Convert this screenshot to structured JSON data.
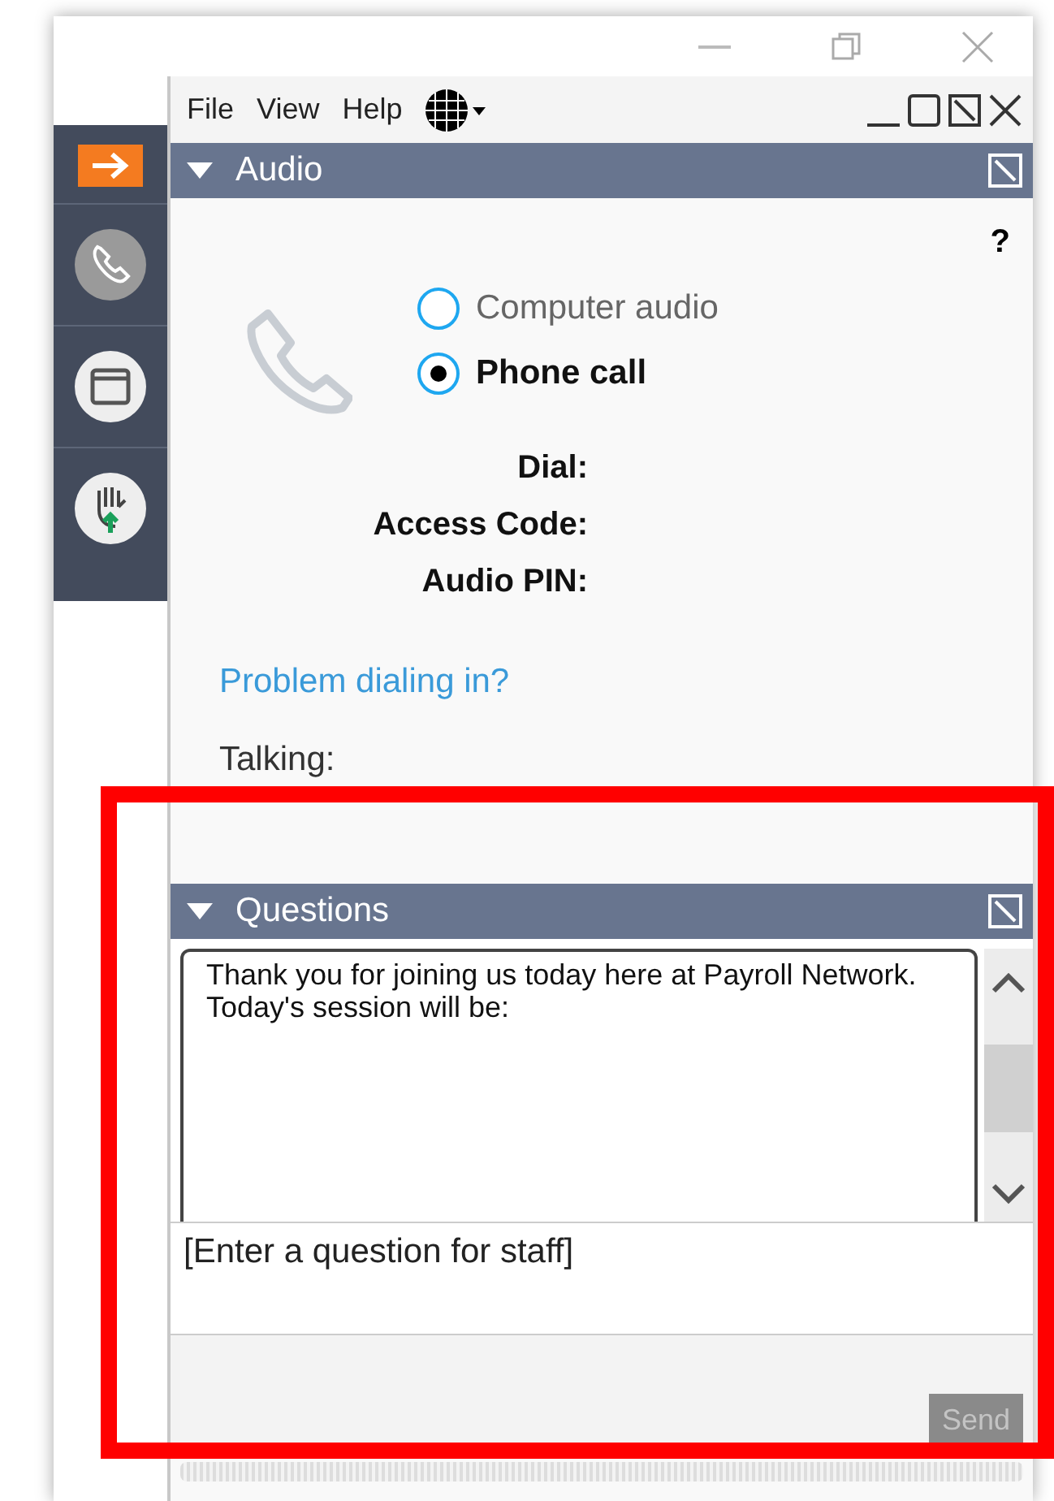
{
  "menu": [
    "File",
    "View",
    "Help"
  ],
  "audio": {
    "title": "Audio",
    "expanded": true,
    "help": "?",
    "options": [
      {
        "label": "Computer audio",
        "selected": false
      },
      {
        "label": "Phone call",
        "selected": true
      }
    ],
    "fields": [
      "Dial:",
      "Access Code:",
      "Audio PIN:"
    ],
    "link": "Problem dialing in?",
    "talking": "Talking:"
  },
  "questions": {
    "title": "Questions",
    "expanded": true,
    "message": "Thank you for joining us today here at Payroll Network.  Today's session will be:",
    "placeholder": "[Enter a question for staff]",
    "send": {
      "label": "Send",
      "disabled": true
    }
  }
}
